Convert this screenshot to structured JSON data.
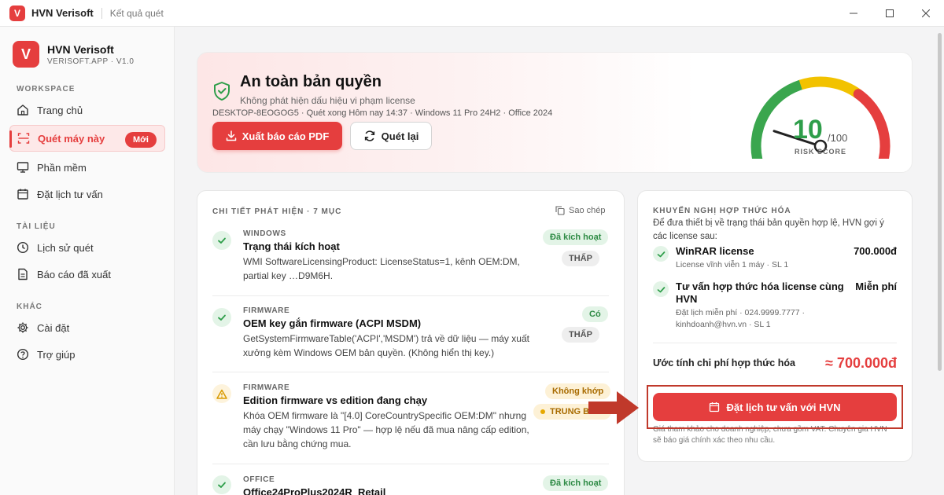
{
  "titlebar": {
    "logo_letter": "V",
    "app_name": "HVN Verisoft",
    "page_name": "Kết quả quét",
    "controls": [
      "minimize",
      "maximize",
      "close"
    ]
  },
  "sidebar": {
    "brand": {
      "logo_letter": "V",
      "name": "HVN Verisoft",
      "sub": "VERISOFT.APP · V1.0"
    },
    "sections": [
      {
        "title": "WORKSPACE",
        "items": [
          {
            "label": "Trang chủ",
            "icon": "home-icon"
          },
          {
            "label": "Quét máy này",
            "icon": "scan-icon",
            "active": true,
            "badge": "Mới"
          },
          {
            "label": "Phần mềm",
            "icon": "monitor-icon"
          },
          {
            "label": "Đặt lịch tư vấn",
            "icon": "calendar-icon"
          }
        ]
      },
      {
        "title": "TÀI LIỆU",
        "items": [
          {
            "label": "Lịch sử quét",
            "icon": "clock-icon"
          },
          {
            "label": "Báo cáo đã xuất",
            "icon": "document-icon"
          }
        ]
      },
      {
        "title": "KHÁC",
        "items": [
          {
            "label": "Cài đặt",
            "icon": "gear-icon"
          },
          {
            "label": "Trợ giúp",
            "icon": "help-icon"
          }
        ]
      }
    ]
  },
  "hero": {
    "title": "An toàn bản quyền",
    "subtitle": "Không phát hiện dấu hiệu vi phạm license",
    "meta": "DESKTOP-8EOGOG5 · Quét xong Hôm nay 14:37 · Windows 11 Pro 24H2 · Office 2024",
    "export_button": "Xuất báo cáo PDF",
    "rescan_button": "Quét lại",
    "gauge": {
      "value": "10",
      "max": "/100",
      "label": "RISK SCORE",
      "fraction": 0.1
    }
  },
  "details": {
    "heading": "CHI TIẾT PHÁT HIỆN · 7 MỤC",
    "copy_label": "Sao chép",
    "items": [
      {
        "status": "ok",
        "category": "WINDOWS",
        "title": "Trạng thái kích hoạt",
        "desc": "WMI SoftwareLicensingProduct: LicenseStatus=1, kênh OEM:DM, partial key …D9M6H.",
        "tag": "Đã kích hoạt",
        "level": "THẤP"
      },
      {
        "status": "ok",
        "category": "FIRMWARE",
        "title": "OEM key gắn firmware (ACPI MSDM)",
        "desc": "GetSystemFirmwareTable('ACPI','MSDM') trả về dữ liệu — máy xuất xưởng kèm Windows OEM bản quyền. (Không hiển thị key.)",
        "tag": "Có",
        "level": "THẤP"
      },
      {
        "status": "warn",
        "category": "FIRMWARE",
        "title": "Edition firmware vs edition đang chạy",
        "desc": "Khóa OEM firmware là \"[4.0] CoreCountrySpecific OEM:DM\" nhưng máy chạy \"Windows 11 Pro\" — hợp lệ nếu đã mua nâng cấp edition, cần lưu bằng chứng mua.",
        "tag": "Không khớp",
        "level": "TRUNG BÌNH"
      },
      {
        "status": "ok",
        "category": "OFFICE",
        "title": "Office24ProPlus2024R_Retail",
        "desc": "",
        "tag": "Đã kích hoạt",
        "level": ""
      }
    ]
  },
  "recommendation": {
    "heading": "KHUYẾN NGHỊ HỢP THỨC HÓA",
    "intro": "Để đưa thiết bị về trạng thái bản quyền hợp lệ, HVN gợi ý các license sau:",
    "items": [
      {
        "name": "WinRAR license",
        "sub": "License vĩnh viễn 1 máy · SL 1",
        "price": "700.000đ"
      },
      {
        "name": "Tư vấn hợp thức hóa license cùng HVN",
        "sub": "Đặt lịch miễn phí · 024.9999.7777 · kinhdoanh@hvn.vn · SL 1",
        "price": "Miễn phí"
      }
    ],
    "estimate_label": "Ước tính chi phí hợp thức hóa",
    "estimate_value": "≈ 700.000đ",
    "book_button": "Đặt lịch tư vấn với HVN",
    "note": "Giá tham khảo cho doanh nghiệp, chưa gồm VAT. Chuyên gia HVN sẽ báo giá chính xác theo nhu cầu."
  },
  "colors": {
    "accent": "#e53e3e",
    "success": "#2e9e4a",
    "warning": "#e6a800"
  }
}
